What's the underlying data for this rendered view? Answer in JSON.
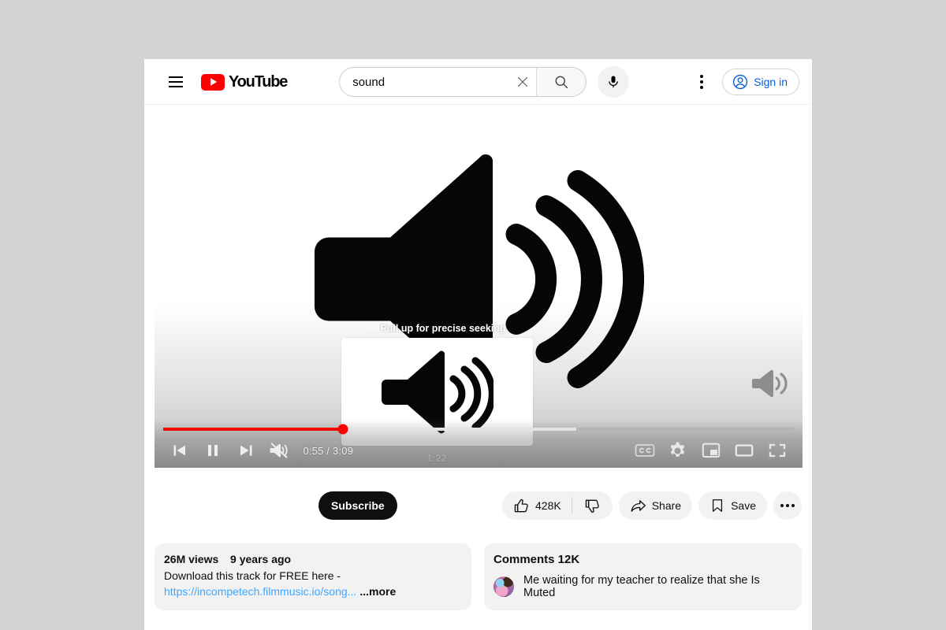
{
  "masthead": {
    "menu_label": "Guide",
    "logo_text": "YouTube",
    "search": {
      "value": "sound",
      "placeholder": "Search",
      "clear_label": "Clear search query",
      "submit_label": "Search"
    },
    "voice_search_label": "Search with your voice",
    "settings_label": "Settings",
    "sign_in_label": "Sign in"
  },
  "player": {
    "seek_hint": "Pull up for precise seeking",
    "seek_preview_time": "1:22",
    "time_display": "0:55 / 3:09",
    "current_time": "0:55",
    "duration": "3:09",
    "progress_percent": 28.6,
    "loaded_percent": 65.5,
    "controls": {
      "previous_label": "Previous",
      "pause_label": "Pause",
      "next_label": "Next",
      "mute_label": "Unmute",
      "subtitles_label": "Subtitles/closed captions",
      "settings_label": "Settings",
      "miniplayer_label": "Miniplayer",
      "theater_label": "Theater mode",
      "fullscreen_label": "Full screen"
    },
    "accent_color": "#ff0000"
  },
  "actions": {
    "subscribe_label": "Subscribe",
    "like_count": "428K",
    "like_label": "Like",
    "dislike_label": "Dislike",
    "share_label": "Share",
    "save_label": "Save",
    "more_label": "More actions"
  },
  "description": {
    "views": "26M views",
    "published": "9 years ago",
    "line1": "Download this track for FREE here -",
    "link_text": "https://incompetech.filmmusic.io/song...",
    "more_label": "...more"
  },
  "comments": {
    "title": "Comments 12K",
    "items": [
      {
        "text": "Me waiting for my teacher to realize that she Is Muted"
      }
    ]
  }
}
